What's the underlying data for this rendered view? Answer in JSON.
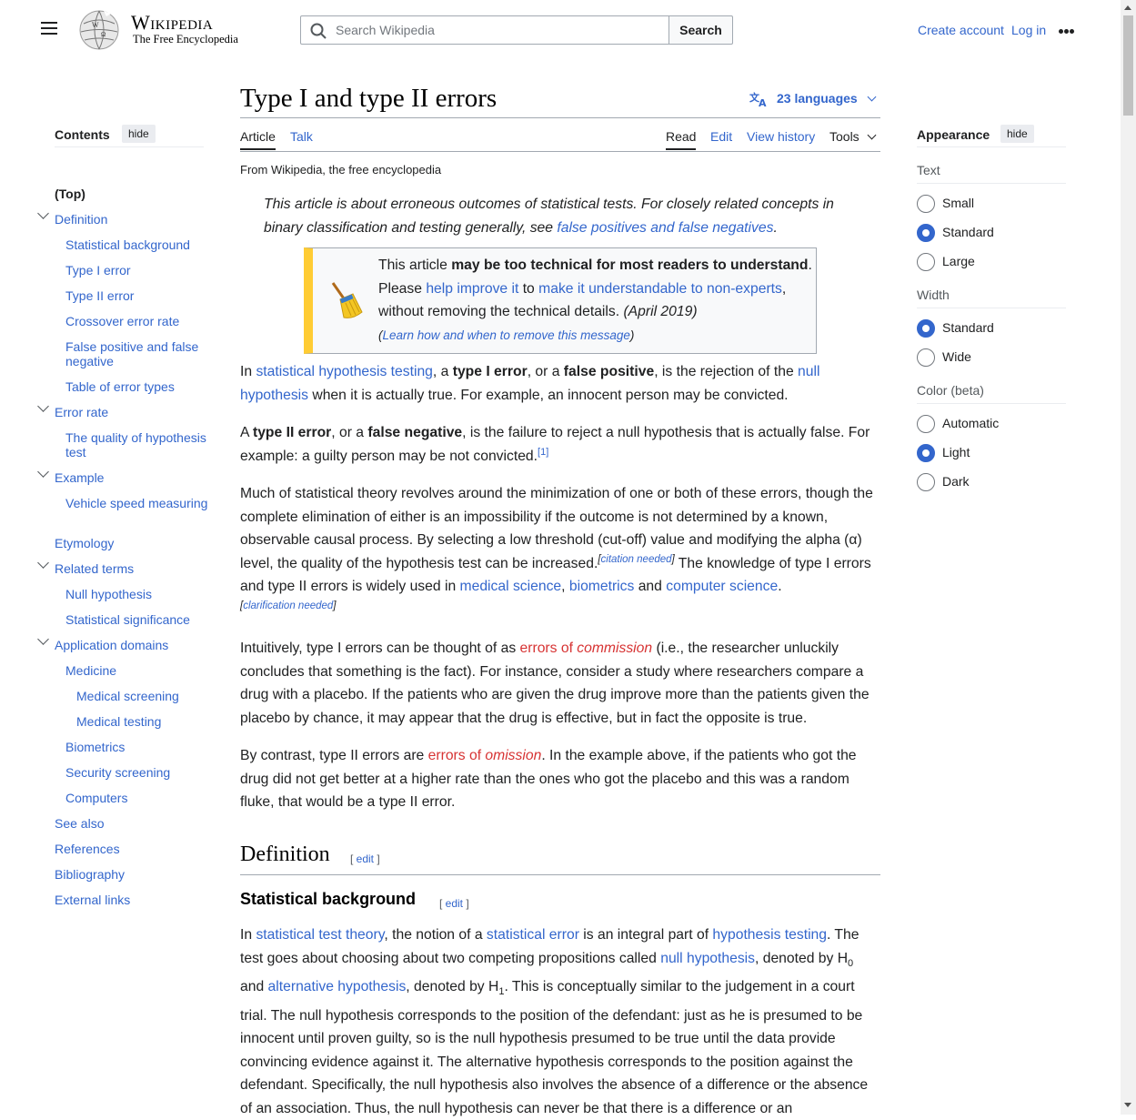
{
  "header": {
    "wordmark": "Wikipedia",
    "tagline": "The Free Encyclopedia",
    "search_placeholder": "Search Wikipedia",
    "search_button": "Search",
    "create_account": "Create account",
    "login": "Log in"
  },
  "toc": {
    "title": "Contents",
    "hide": "hide",
    "items": [
      {
        "label": "(Top)",
        "level": 1,
        "top": true
      },
      {
        "label": "Definition",
        "level": 1,
        "expandable": true
      },
      {
        "label": "Statistical background",
        "level": 2
      },
      {
        "label": "Type I error",
        "level": 2
      },
      {
        "label": "Type II error",
        "level": 2
      },
      {
        "label": "Crossover error rate",
        "level": 2
      },
      {
        "label": "False positive and false negative",
        "level": 2
      },
      {
        "label": "Table of error types",
        "level": 2
      },
      {
        "label": "Error rate",
        "level": 1,
        "expandable": true
      },
      {
        "label": "The quality of hypothesis test",
        "level": 2
      },
      {
        "label": "Example",
        "level": 1,
        "expandable": true
      },
      {
        "label": "Vehicle speed measuring",
        "level": 2
      },
      {
        "label": "Etymology",
        "level": 1
      },
      {
        "label": "Related terms",
        "level": 1,
        "expandable": true
      },
      {
        "label": "Null hypothesis",
        "level": 2
      },
      {
        "label": "Statistical significance",
        "level": 2
      },
      {
        "label": "Application domains",
        "level": 1,
        "expandable": true
      },
      {
        "label": "Medicine",
        "level": 2
      },
      {
        "label": "Medical screening",
        "level": 3
      },
      {
        "label": "Medical testing",
        "level": 3
      },
      {
        "label": "Biometrics",
        "level": 2
      },
      {
        "label": "Security screening",
        "level": 2
      },
      {
        "label": "Computers",
        "level": 2
      },
      {
        "label": "See also",
        "level": 1
      },
      {
        "label": "References",
        "level": 1
      },
      {
        "label": "Bibliography",
        "level": 1
      },
      {
        "label": "External links",
        "level": 1
      }
    ]
  },
  "article": {
    "title": "Type I and type II errors",
    "languages": "23 languages",
    "tabs": {
      "article": "Article",
      "talk": "Talk",
      "read": "Read",
      "edit": "Edit",
      "history": "View history",
      "tools": "Tools"
    },
    "from": "From Wikipedia, the free encyclopedia",
    "hatnote": {
      "text": "This article is about erroneous outcomes of statistical tests. For closely related concepts in binary classification and testing generally, see ",
      "link": "false positives and false negatives",
      "end": "."
    },
    "ambox": {
      "t1": "This article ",
      "b1": "may be too technical for most readers to understand",
      "t2": ". Please ",
      "l1": "help improve it",
      "t3": " to ",
      "l2": "make it understandable to non-experts",
      "t4": ", without removing the technical details.",
      "date": " (April 2019)",
      "learn_open": "(",
      "learn": "Learn how and when to remove this message",
      "learn_close": ")"
    },
    "p1": {
      "t0": "In ",
      "l0": "statistical hypothesis testing",
      "t1": ", a ",
      "b1": "type I error",
      "t2": ", or a ",
      "b2": "false positive",
      "t3": ", is the rejection of the ",
      "l1": "null hypothesis",
      "t4": " when it is actually true. For example, an innocent person may be convicted."
    },
    "p2": {
      "t0": "A ",
      "b1": "type II error",
      "t1": ", or a ",
      "b2": "false negative",
      "t2": ", is the failure to reject a null hypothesis that is actually false. For example: a guilty person may be not convicted.",
      "ref": "[1]"
    },
    "p3": {
      "t0": "Much of statistical theory revolves around the minimization of one or both of these errors, though the complete elimination of either is an impossibility if the outcome is not determined by a known, observable causal process. By selecting a low threshold (cut-off) value and modifying the alpha (α) level, the quality of the hypothesis test can be increased.",
      "c1_open": "[",
      "c1": "citation needed",
      "c1_close": "]",
      "t1": " The knowledge of type I errors and type II errors is widely used in ",
      "l1": "medical science",
      "t2": ", ",
      "l2": "biometrics",
      "t3": " and ",
      "l3": "computer science",
      "t4": ".",
      "c2_open": "[",
      "c2": "clarification needed",
      "c2_close": "]"
    },
    "p4": {
      "t0": "Intuitively, type I errors can be thought of as ",
      "r1": "errors of ",
      "r1i": "commission",
      "t1": " (i.e., the researcher unluckily concludes that something is the fact). For instance, consider a study where researchers compare a drug with a placebo. If the patients who are given the drug improve more than the patients given the placebo by chance, it may appear that the drug is effective, but in fact the opposite is true."
    },
    "p5": {
      "t0": "By contrast, type II errors are ",
      "r1": "errors of ",
      "r1i": "omission",
      "t1": ". In the example above, if the patients who got the drug did not get better at a higher rate than the ones who got the placebo and this was a random fluke, that would be a type II error."
    },
    "h_definition": "Definition",
    "h_statistical": "Statistical background",
    "edit_open": "[ ",
    "edit": "edit",
    "edit_close": " ]",
    "p6": {
      "t0": "In ",
      "l0": "statistical test theory",
      "t1": ", the notion of a ",
      "l1": "statistical error",
      "t2": " is an integral part of ",
      "l2": "hypothesis testing",
      "t3": ". The test goes about choosing about two competing propositions called ",
      "l3": "null hypothesis",
      "t4": ", denoted by H",
      "s1": "0",
      "t5": " and ",
      "l4": "alternative hypothesis",
      "t6": ", denoted by H",
      "s2": "1",
      "t7": ". This is conceptually similar to the judgement in a court trial. The null hypothesis corresponds to the position of the defendant: just as he is presumed to be innocent until proven guilty, so is the null hypothesis presumed to be true until the data provide convincing evidence against it. The alternative hypothesis corresponds to the position against the defendant. Specifically, the null hypothesis also involves the absence of a difference or the absence of an association. Thus, the null hypothesis can never be that there is a difference or an"
    }
  },
  "appearance": {
    "title": "Appearance",
    "hide": "hide",
    "text_label": "Text",
    "text_options": [
      "Small",
      "Standard",
      "Large"
    ],
    "text_selected": "Standard",
    "width_label": "Width",
    "width_options": [
      "Standard",
      "Wide"
    ],
    "width_selected": "Standard",
    "color_label": "Color (beta)",
    "color_options": [
      "Automatic",
      "Light",
      "Dark"
    ],
    "color_selected": "Light"
  },
  "colors": {
    "link": "#3366cc",
    "redlink": "#d73333",
    "text": "#202122",
    "ambox_stripe": "#ffcc33"
  }
}
